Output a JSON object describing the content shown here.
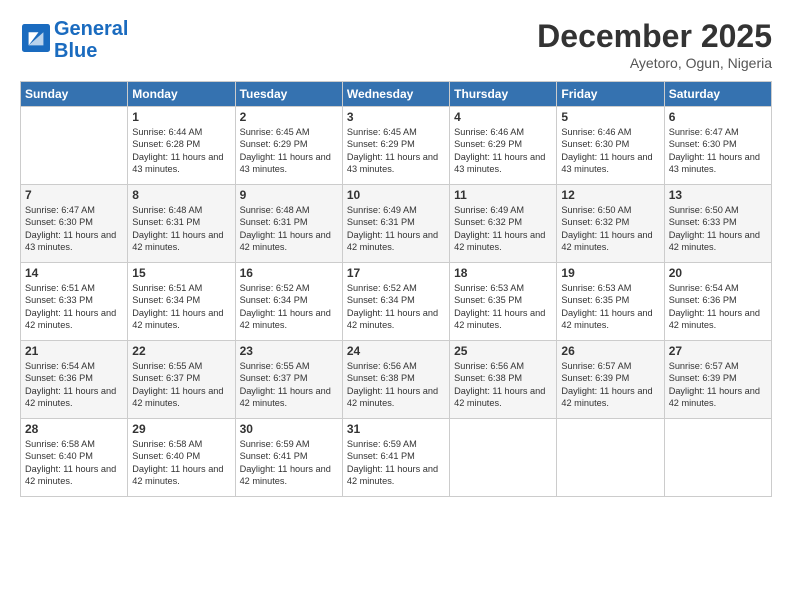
{
  "logo": {
    "line1": "General",
    "line2": "Blue"
  },
  "title": "December 2025",
  "location": "Ayetoro, Ogun, Nigeria",
  "days_of_week": [
    "Sunday",
    "Monday",
    "Tuesday",
    "Wednesday",
    "Thursday",
    "Friday",
    "Saturday"
  ],
  "weeks": [
    [
      {
        "day": "",
        "sunrise": "",
        "sunset": "",
        "daylight": ""
      },
      {
        "day": "1",
        "sunrise": "Sunrise: 6:44 AM",
        "sunset": "Sunset: 6:28 PM",
        "daylight": "Daylight: 11 hours and 43 minutes."
      },
      {
        "day": "2",
        "sunrise": "Sunrise: 6:45 AM",
        "sunset": "Sunset: 6:29 PM",
        "daylight": "Daylight: 11 hours and 43 minutes."
      },
      {
        "day": "3",
        "sunrise": "Sunrise: 6:45 AM",
        "sunset": "Sunset: 6:29 PM",
        "daylight": "Daylight: 11 hours and 43 minutes."
      },
      {
        "day": "4",
        "sunrise": "Sunrise: 6:46 AM",
        "sunset": "Sunset: 6:29 PM",
        "daylight": "Daylight: 11 hours and 43 minutes."
      },
      {
        "day": "5",
        "sunrise": "Sunrise: 6:46 AM",
        "sunset": "Sunset: 6:30 PM",
        "daylight": "Daylight: 11 hours and 43 minutes."
      },
      {
        "day": "6",
        "sunrise": "Sunrise: 6:47 AM",
        "sunset": "Sunset: 6:30 PM",
        "daylight": "Daylight: 11 hours and 43 minutes."
      }
    ],
    [
      {
        "day": "7",
        "sunrise": "Sunrise: 6:47 AM",
        "sunset": "Sunset: 6:30 PM",
        "daylight": "Daylight: 11 hours and 43 minutes."
      },
      {
        "day": "8",
        "sunrise": "Sunrise: 6:48 AM",
        "sunset": "Sunset: 6:31 PM",
        "daylight": "Daylight: 11 hours and 42 minutes."
      },
      {
        "day": "9",
        "sunrise": "Sunrise: 6:48 AM",
        "sunset": "Sunset: 6:31 PM",
        "daylight": "Daylight: 11 hours and 42 minutes."
      },
      {
        "day": "10",
        "sunrise": "Sunrise: 6:49 AM",
        "sunset": "Sunset: 6:31 PM",
        "daylight": "Daylight: 11 hours and 42 minutes."
      },
      {
        "day": "11",
        "sunrise": "Sunrise: 6:49 AM",
        "sunset": "Sunset: 6:32 PM",
        "daylight": "Daylight: 11 hours and 42 minutes."
      },
      {
        "day": "12",
        "sunrise": "Sunrise: 6:50 AM",
        "sunset": "Sunset: 6:32 PM",
        "daylight": "Daylight: 11 hours and 42 minutes."
      },
      {
        "day": "13",
        "sunrise": "Sunrise: 6:50 AM",
        "sunset": "Sunset: 6:33 PM",
        "daylight": "Daylight: 11 hours and 42 minutes."
      }
    ],
    [
      {
        "day": "14",
        "sunrise": "Sunrise: 6:51 AM",
        "sunset": "Sunset: 6:33 PM",
        "daylight": "Daylight: 11 hours and 42 minutes."
      },
      {
        "day": "15",
        "sunrise": "Sunrise: 6:51 AM",
        "sunset": "Sunset: 6:34 PM",
        "daylight": "Daylight: 11 hours and 42 minutes."
      },
      {
        "day": "16",
        "sunrise": "Sunrise: 6:52 AM",
        "sunset": "Sunset: 6:34 PM",
        "daylight": "Daylight: 11 hours and 42 minutes."
      },
      {
        "day": "17",
        "sunrise": "Sunrise: 6:52 AM",
        "sunset": "Sunset: 6:34 PM",
        "daylight": "Daylight: 11 hours and 42 minutes."
      },
      {
        "day": "18",
        "sunrise": "Sunrise: 6:53 AM",
        "sunset": "Sunset: 6:35 PM",
        "daylight": "Daylight: 11 hours and 42 minutes."
      },
      {
        "day": "19",
        "sunrise": "Sunrise: 6:53 AM",
        "sunset": "Sunset: 6:35 PM",
        "daylight": "Daylight: 11 hours and 42 minutes."
      },
      {
        "day": "20",
        "sunrise": "Sunrise: 6:54 AM",
        "sunset": "Sunset: 6:36 PM",
        "daylight": "Daylight: 11 hours and 42 minutes."
      }
    ],
    [
      {
        "day": "21",
        "sunrise": "Sunrise: 6:54 AM",
        "sunset": "Sunset: 6:36 PM",
        "daylight": "Daylight: 11 hours and 42 minutes."
      },
      {
        "day": "22",
        "sunrise": "Sunrise: 6:55 AM",
        "sunset": "Sunset: 6:37 PM",
        "daylight": "Daylight: 11 hours and 42 minutes."
      },
      {
        "day": "23",
        "sunrise": "Sunrise: 6:55 AM",
        "sunset": "Sunset: 6:37 PM",
        "daylight": "Daylight: 11 hours and 42 minutes."
      },
      {
        "day": "24",
        "sunrise": "Sunrise: 6:56 AM",
        "sunset": "Sunset: 6:38 PM",
        "daylight": "Daylight: 11 hours and 42 minutes."
      },
      {
        "day": "25",
        "sunrise": "Sunrise: 6:56 AM",
        "sunset": "Sunset: 6:38 PM",
        "daylight": "Daylight: 11 hours and 42 minutes."
      },
      {
        "day": "26",
        "sunrise": "Sunrise: 6:57 AM",
        "sunset": "Sunset: 6:39 PM",
        "daylight": "Daylight: 11 hours and 42 minutes."
      },
      {
        "day": "27",
        "sunrise": "Sunrise: 6:57 AM",
        "sunset": "Sunset: 6:39 PM",
        "daylight": "Daylight: 11 hours and 42 minutes."
      }
    ],
    [
      {
        "day": "28",
        "sunrise": "Sunrise: 6:58 AM",
        "sunset": "Sunset: 6:40 PM",
        "daylight": "Daylight: 11 hours and 42 minutes."
      },
      {
        "day": "29",
        "sunrise": "Sunrise: 6:58 AM",
        "sunset": "Sunset: 6:40 PM",
        "daylight": "Daylight: 11 hours and 42 minutes."
      },
      {
        "day": "30",
        "sunrise": "Sunrise: 6:59 AM",
        "sunset": "Sunset: 6:41 PM",
        "daylight": "Daylight: 11 hours and 42 minutes."
      },
      {
        "day": "31",
        "sunrise": "Sunrise: 6:59 AM",
        "sunset": "Sunset: 6:41 PM",
        "daylight": "Daylight: 11 hours and 42 minutes."
      },
      {
        "day": "",
        "sunrise": "",
        "sunset": "",
        "daylight": ""
      },
      {
        "day": "",
        "sunrise": "",
        "sunset": "",
        "daylight": ""
      },
      {
        "day": "",
        "sunrise": "",
        "sunset": "",
        "daylight": ""
      }
    ]
  ]
}
